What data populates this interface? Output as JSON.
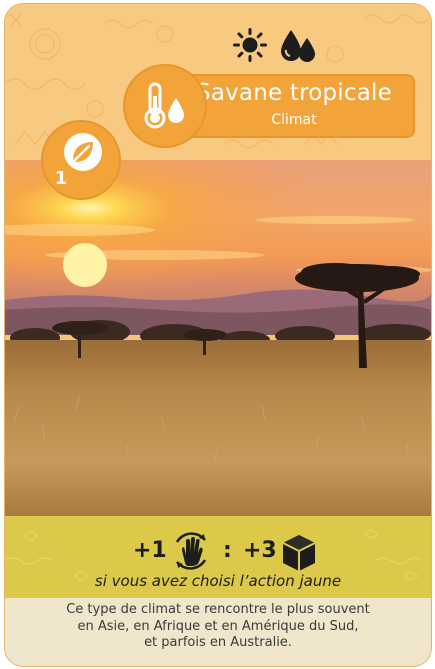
{
  "card": {
    "title": "Savane tropicale",
    "category": "Climat",
    "level": "1",
    "icons": {
      "weather": [
        "sun-icon",
        "water-drops-icon"
      ],
      "category": "thermometer-drop-icon",
      "badge": "leaf-icon",
      "action": "grab-hand-icon",
      "reward": "cube-icon"
    },
    "action": {
      "cost": "+1",
      "separator": ":",
      "reward": "+3",
      "caption": "si vous avez choisi l’action jaune"
    },
    "description": [
      "Ce type de climat se rencontre le plus souvent",
      "en Asie, en Afrique et en Amérique du Sud,",
      "et parfois en Australie."
    ],
    "colors": {
      "header": "#f8c981",
      "banner": "#f2a43a",
      "action_band": "#dcc94a",
      "description_band": "#efe6cc"
    }
  }
}
